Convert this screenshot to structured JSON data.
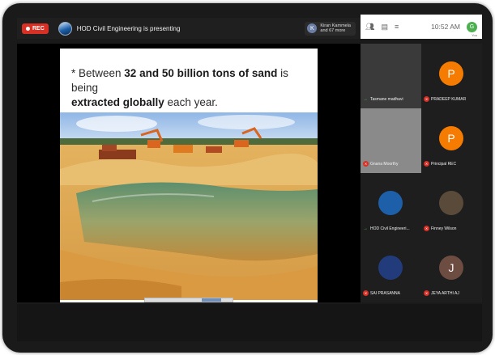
{
  "meeting": {
    "rec_label": "REC",
    "presenting_text": "HOD Civil Engineering is presenting",
    "viewers": {
      "avatar_initial": "K",
      "line1": "Kiran Kammela",
      "line2": "and 67 more"
    }
  },
  "status": {
    "time": "10:52 AM",
    "avatar_initial": "G",
    "you_label": "You"
  },
  "slide": {
    "line1_pre": "* Between ",
    "line1_bold": "32 and 50 billion tons of sand",
    "line1_post": " is being",
    "line2_bold": "extracted globally",
    "line2_post": " each year."
  },
  "participants": [
    {
      "name": "Tasmane madhavi",
      "initial": "",
      "mic": "on",
      "bg": "#3a3a3a",
      "avatar_color": ""
    },
    {
      "name": "PRADEEP KUMAR",
      "initial": "P",
      "mic": "off",
      "bg": "#1e1e1e",
      "avatar_color": "#f57c00"
    },
    {
      "name": "Gnana Moorthy",
      "initial": "",
      "mic": "off",
      "bg": "#8a8a8a",
      "avatar_color": ""
    },
    {
      "name": "Principal REC",
      "initial": "P",
      "mic": "off",
      "bg": "#1e1e1e",
      "avatar_color": "#f57c00"
    },
    {
      "name": "HOD Civil Engineeri...",
      "initial": "",
      "mic": "on",
      "bg": "#1e1e1e",
      "avatar_color": "#1d5fa8"
    },
    {
      "name": "Finney Wilson",
      "initial": "",
      "mic": "off",
      "bg": "#1e1e1e",
      "avatar_color": "#5a4a3a"
    },
    {
      "name": "SAI PRASANNA",
      "initial": "",
      "mic": "off",
      "bg": "#1e1e1e",
      "avatar_color": "#223b7a"
    },
    {
      "name": "JEYA ARTHI AJ",
      "initial": "J",
      "mic": "off",
      "bg": "#1e1e1e",
      "avatar_color": "#6d4c41"
    }
  ],
  "colors": {
    "rec": "#d93025",
    "avatar_orange": "#f57c00",
    "mic_on": "#4caf50"
  }
}
